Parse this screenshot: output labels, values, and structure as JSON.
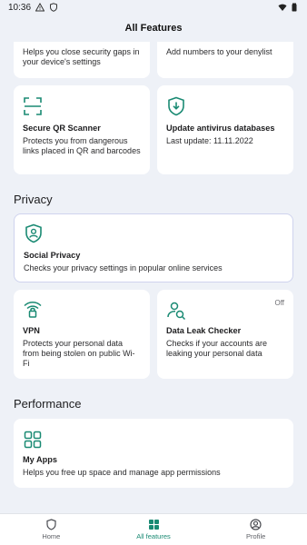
{
  "status_bar": {
    "time": "10:36",
    "icons": [
      "warning-icon",
      "shield-status-icon",
      "wifi-icon",
      "battery-icon"
    ]
  },
  "header": {
    "title": "All Features"
  },
  "cards_top": [
    {
      "title": "",
      "desc": "Helps you close security gaps in your device's settings",
      "icon": "none"
    },
    {
      "title": "",
      "desc": "Add numbers to your denylist",
      "icon": "none"
    },
    {
      "title": "Secure QR Scanner",
      "desc": "Protects you from dangerous links placed in QR and barcodes",
      "icon": "qr-scan-icon"
    },
    {
      "title": "Update antivirus databases",
      "desc": "Last update: 11.11.2022",
      "icon": "shield-download-icon"
    }
  ],
  "privacy": {
    "section_title": "Privacy",
    "social": {
      "title": "Social Privacy",
      "desc": "Checks your privacy settings in popular online services",
      "icon": "shield-person-icon"
    },
    "vpn": {
      "title": "VPN",
      "desc": "Protects your personal data from being stolen on public Wi-Fi",
      "icon": "wifi-lock-icon"
    },
    "data_leak": {
      "title": "Data Leak Checker",
      "desc": "Checks if your accounts are leaking your personal data",
      "badge": "Off",
      "icon": "person-search-icon"
    }
  },
  "performance": {
    "section_title": "Performance",
    "my_apps": {
      "title": "My Apps",
      "desc": "Helps you free up space and manage app permissions",
      "icon": "apps-grid-icon"
    }
  },
  "bottom_nav": [
    {
      "label": "Home",
      "icon": "shield-outline-icon",
      "active": false
    },
    {
      "label": "All features",
      "icon": "grid-icon",
      "active": true
    },
    {
      "label": "Profile",
      "icon": "profile-icon",
      "active": false
    }
  ],
  "colors": {
    "accent": "#1a8a73",
    "background": "#eef1f7",
    "card": "#ffffff"
  }
}
